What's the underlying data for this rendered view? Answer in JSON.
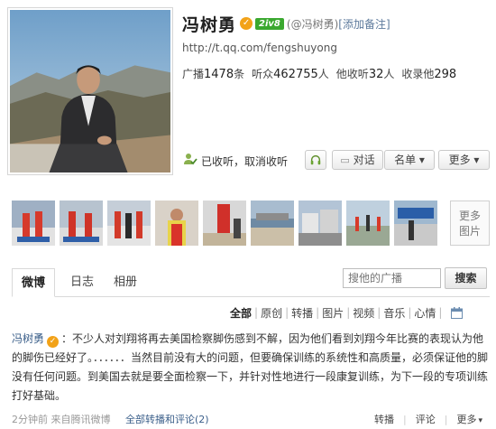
{
  "profile": {
    "name": "冯树勇",
    "level_badge": "2iv8",
    "handle": "(@冯树勇)",
    "remark_link": "[添加备注]",
    "url": "http://t.qq.com/fengshuyong",
    "stats": [
      {
        "label": "广播",
        "value": "1478",
        "unit": "条"
      },
      {
        "label": "听众",
        "value": "462755",
        "unit": "人"
      },
      {
        "label": "他收听",
        "value": "32",
        "unit": "人"
      },
      {
        "label": "收录他",
        "value": "298",
        "unit": ""
      }
    ]
  },
  "actions": {
    "followed": "已收听，取消收听",
    "chat_label": "对话",
    "list_label": "名单",
    "more_label": "更多",
    "dropdown_glyph": "▾",
    "headset_icon": "headset-icon"
  },
  "photos": {
    "count_visible": 9,
    "more_label_1": "更多",
    "more_label_2": "图片"
  },
  "tabs": [
    {
      "label": "微博"
    },
    {
      "label": "日志"
    },
    {
      "label": "相册"
    }
  ],
  "search": {
    "placeholder": "搜他的广播",
    "button_label": "搜索"
  },
  "filters": [
    {
      "label": "全部"
    },
    {
      "label": "原创"
    },
    {
      "label": "转播"
    },
    {
      "label": "图片"
    },
    {
      "label": "视频"
    },
    {
      "label": "音乐"
    },
    {
      "label": "心情"
    }
  ],
  "post": {
    "author": "冯树勇",
    "content": "：不少人对刘翔将再去美国检察脚伤感到不解，因为他们看到刘翔今年比赛的表现认为他的脚伤已经好了。．．．．．．当然目前没有大的问题，但要确保训练的系统性和高质量，必须保证他的脚没有任何问题。到美国去就是要全面检察一下，并针对性地进行一段康复训练，为下一段的专项训练打好基础。",
    "time_source": "2分钟前 来自腾讯微博",
    "all_link": "全部转播和评论(2)",
    "repost_label": "转播",
    "comment_label": "评论",
    "more_label": "更多"
  },
  "colors": {
    "link": "#3b5f8a",
    "verify": "#f2a218",
    "level": "#3aa82f"
  }
}
